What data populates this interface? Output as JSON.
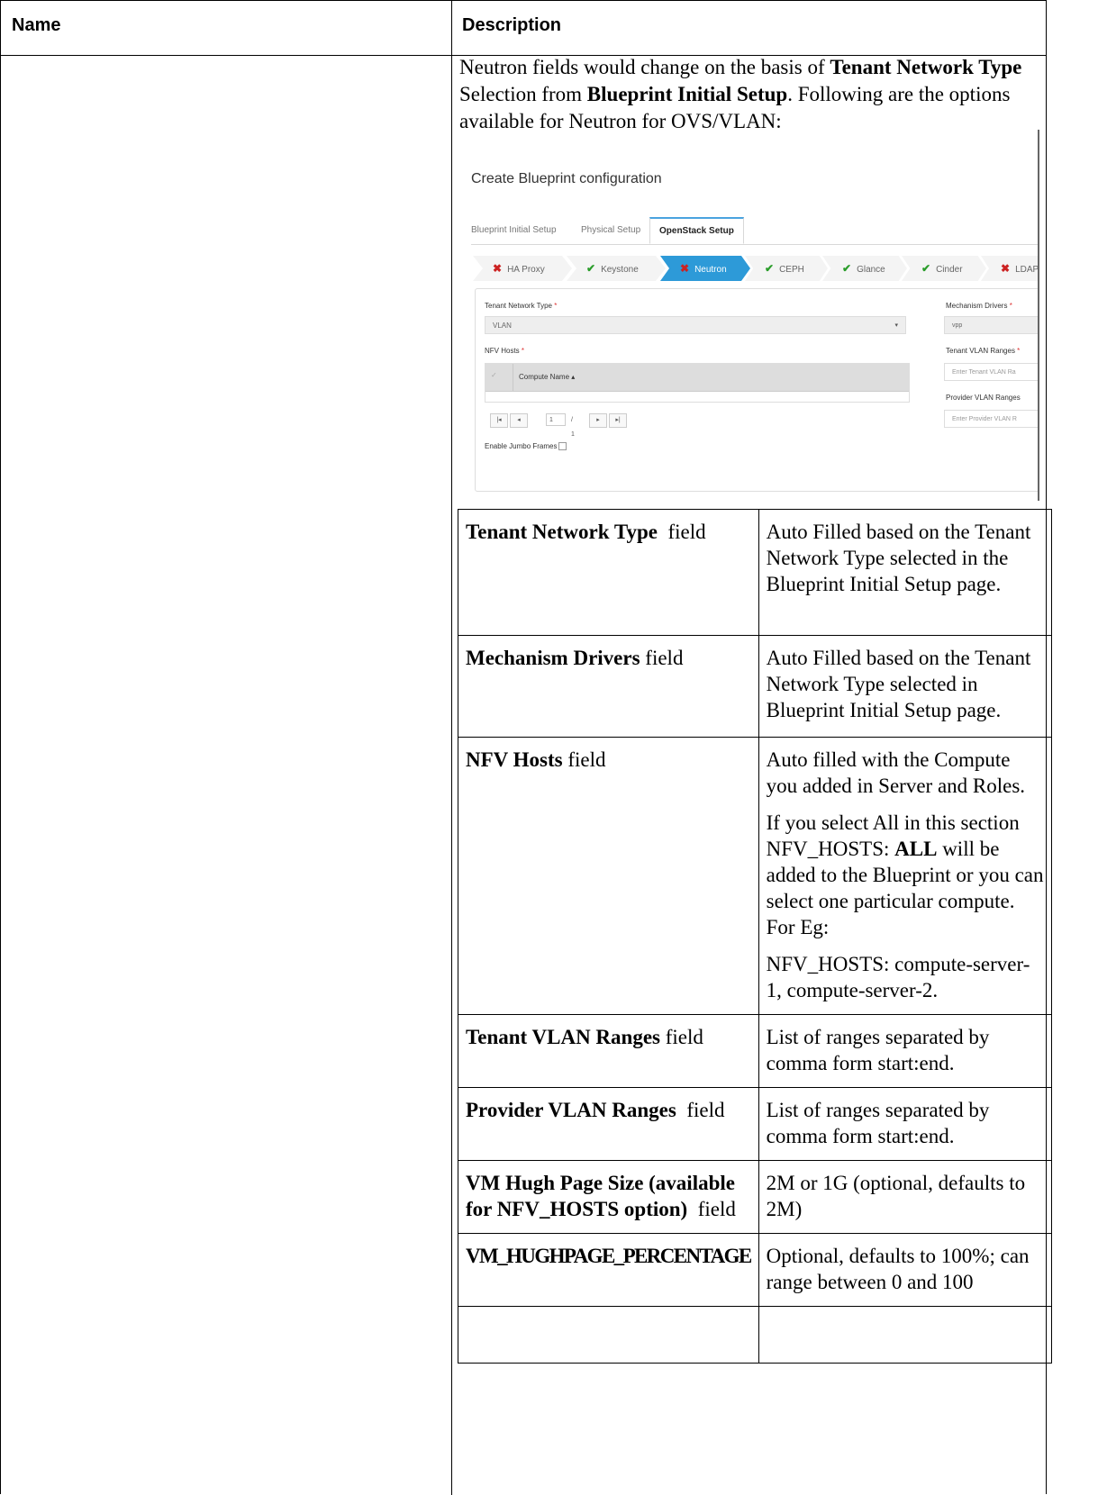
{
  "header": {
    "name_label": "Name",
    "description_label": "Description"
  },
  "intro": {
    "part1": "Neutron fields would change on the basis of ",
    "bold1": "Tenant Network Type",
    "part2": " Selection from ",
    "bold2": "Blueprint Initial Setup",
    "part3": ". Following are the options available for Neutron for OVS/VLAN:"
  },
  "screenshot": {
    "title": "Create Blueprint configuration",
    "tabs": [
      {
        "label": "Blueprint Initial Setup",
        "active": false
      },
      {
        "label": "Physical Setup",
        "active": false
      },
      {
        "label": "OpenStack Setup",
        "active": true
      }
    ],
    "steps": [
      {
        "label": "HA Proxy",
        "status": "error"
      },
      {
        "label": "Keystone",
        "status": "ok"
      },
      {
        "label": "Neutron",
        "status": "error",
        "active": true
      },
      {
        "label": "CEPH",
        "status": "ok"
      },
      {
        "label": "Glance",
        "status": "ok"
      },
      {
        "label": "Cinder",
        "status": "ok"
      },
      {
        "label": "LDAP",
        "status": "error"
      }
    ],
    "form": {
      "tenant_network_type_label": "Tenant Network Type",
      "tenant_network_type_value": "VLAN",
      "nfv_hosts_label": "NFV Hosts",
      "compute_name_column": "Compute Name",
      "page_current": "1",
      "page_of": "/ 1",
      "jumbo_label": "Enable Jumbo Frames",
      "mechanism_drivers_label": "Mechanism Drivers",
      "mechanism_drivers_value": "vpp",
      "tenant_vlan_label": "Tenant VLAN Ranges",
      "tenant_vlan_placeholder": "Enter Tenant VLAN Ra",
      "provider_vlan_label": "Provider VLAN Ranges",
      "provider_vlan_placeholder": "Enter Provider VLAN R",
      "required_marker": "*"
    },
    "colors": {
      "active_step": "#2d9ad8",
      "error_mark": "#cc2222",
      "ok_mark": "#2a9d2a"
    }
  },
  "rows": [
    {
      "name_bold": "Tenant Network Type",
      "name_suffix": "  field",
      "desc": [
        "Auto Filled based on the Tenant Network Type selected in the Blueprint Initial Setup page."
      ]
    },
    {
      "name_bold": "Mechanism Drivers",
      "name_suffix": " field",
      "desc": [
        "Auto Filled based on the Tenant Network Type selected in Blueprint Initial Setup page."
      ]
    },
    {
      "name_bold": "NFV Hosts",
      "name_suffix": " field",
      "desc": [
        "Auto filled with the Compute you added in Server and Roles.",
        {
          "pre": "If you select All in this section NFV_HOSTS: ",
          "bold": "ALL",
          "post": " will be added to the Blueprint or you can select one particular compute. For Eg:"
        },
        "NFV_HOSTS: compute-server-1, compute-server-2."
      ]
    },
    {
      "name_bold": "Tenant VLAN Ranges",
      "name_suffix": " field",
      "desc": [
        "List of ranges separated by comma form start:end."
      ]
    },
    {
      "name_bold": "Provider VLAN Ranges",
      "name_suffix": "  field",
      "desc": [
        "List of ranges separated by comma form start:end."
      ]
    },
    {
      "name_bold": "VM Hugh Page Size (available for NFV_HOSTS option)",
      "name_suffix": "  field",
      "desc": [
        "2M or 1G (optional, defaults to 2M)"
      ]
    },
    {
      "name_bold": "VM_HUGHPAGE_PERCENTAGE",
      "name_suffix": "",
      "desc": [
        "Optional, defaults to 100%; can range between 0 and 100"
      ]
    }
  ]
}
